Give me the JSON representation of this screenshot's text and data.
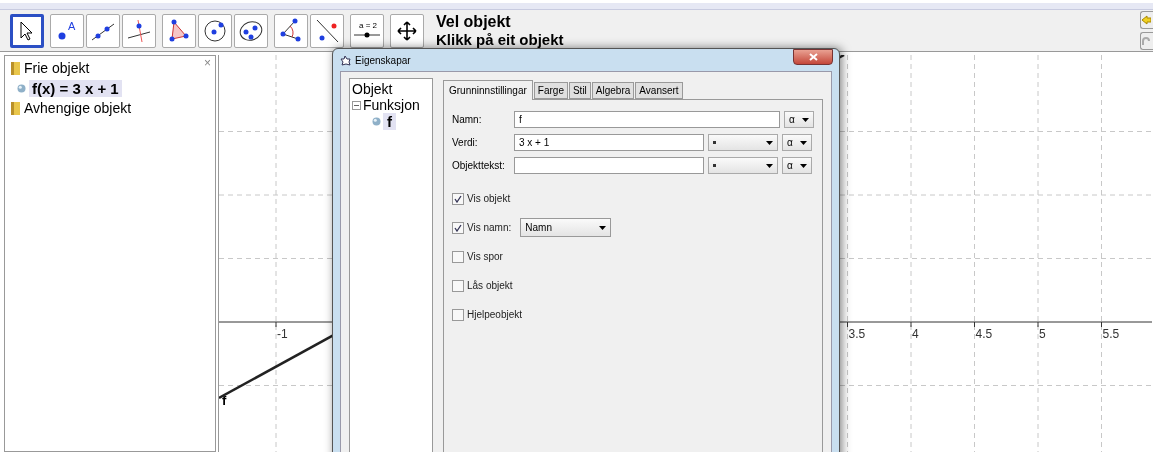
{
  "toolbar": {
    "tools": [
      {
        "kind": "move",
        "selected": true
      },
      {
        "kind": "point",
        "selected": false,
        "label": "A"
      },
      {
        "kind": "line",
        "selected": false
      },
      {
        "kind": "perpendicular",
        "selected": false
      },
      {
        "kind": "polygon",
        "selected": false
      },
      {
        "kind": "circle",
        "selected": false
      },
      {
        "kind": "conic",
        "selected": false
      },
      {
        "kind": "angle",
        "selected": false
      },
      {
        "kind": "reflect",
        "selected": false
      },
      {
        "kind": "slider",
        "selected": false,
        "label": "a = 2"
      },
      {
        "kind": "pan",
        "selected": false
      }
    ],
    "title": "Vel objekt",
    "hint": "Klikk på eit objekt"
  },
  "algebra": {
    "close": "×",
    "groups": [
      {
        "label": "Frie objekt",
        "children": [
          {
            "label": "f(x) = 3 x + 1",
            "selected": true
          }
        ]
      },
      {
        "label": "Avhengige objekt"
      }
    ]
  },
  "graphics": {
    "x_ticks": [
      "-1",
      "3.5",
      "4",
      "4.5",
      "5",
      "5.5"
    ],
    "curve_label": "f"
  },
  "dialog": {
    "title": "Eigenskapar",
    "tree": {
      "label": "Objekt",
      "children": [
        {
          "label": "Funksjon",
          "expanded": true,
          "children": [
            {
              "label": "f",
              "selected": true
            }
          ]
        }
      ]
    },
    "tabs": [
      {
        "label": "Grunninnstillingar",
        "selected": true
      },
      {
        "label": "Farge",
        "selected": false
      },
      {
        "label": "Stil",
        "selected": false
      },
      {
        "label": "Algebra",
        "selected": false
      },
      {
        "label": "Avansert",
        "selected": false
      }
    ],
    "fields": [
      {
        "label": "Namn:",
        "value": "f",
        "symbol": "α"
      },
      {
        "label": "Verdi:",
        "value": "3 x + 1",
        "has_format": true,
        "symbol": "α"
      },
      {
        "label": "Objekttekst:",
        "has_format": true,
        "symbol": "α"
      }
    ],
    "checkboxes": [
      {
        "label": "Vis objekt",
        "checked": true
      },
      {
        "label": "Vis namn:",
        "checked": true,
        "select": "Namn"
      },
      {
        "label": "Vis spor",
        "checked": false
      },
      {
        "label": "Lås objekt",
        "checked": false
      },
      {
        "label": "Hjelpeobjekt",
        "checked": false
      }
    ]
  }
}
